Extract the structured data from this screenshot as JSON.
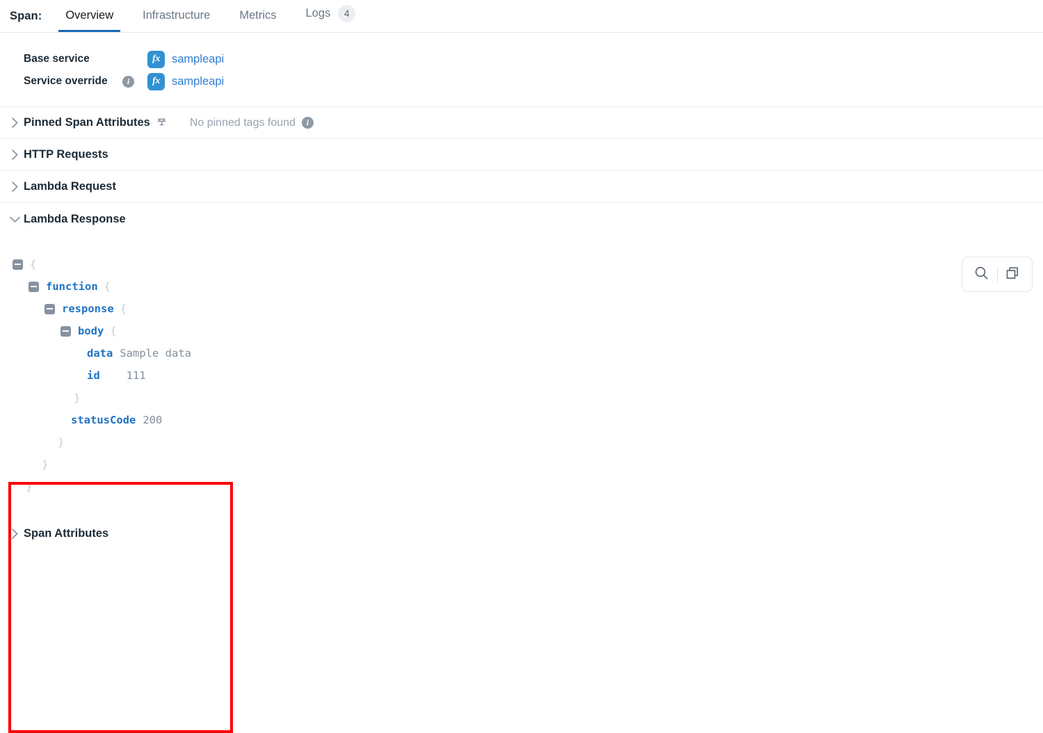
{
  "tabbar": {
    "label": "Span:",
    "tabs": [
      {
        "label": "Overview",
        "active": true,
        "badge": ""
      },
      {
        "label": "Infrastructure",
        "active": false,
        "badge": ""
      },
      {
        "label": "Metrics",
        "active": false,
        "badge": ""
      },
      {
        "label": "Logs",
        "active": false,
        "badge": "4"
      }
    ]
  },
  "service": {
    "base_label": "Base service",
    "base_value": "sampleapi",
    "override_label": "Service override",
    "override_value": "sampleapi",
    "fx_icon_text": "fx",
    "info_icon_text": "i"
  },
  "sections": {
    "pinned": {
      "title": "Pinned Span Attributes",
      "note": "No pinned tags found",
      "expanded": false
    },
    "http_requests": {
      "title": "HTTP Requests",
      "expanded": false
    },
    "lambda_request": {
      "title": "Lambda Request",
      "expanded": false
    },
    "lambda_response": {
      "title": "Lambda Response",
      "expanded": true
    },
    "span_attributes": {
      "title": "Span Attributes",
      "expanded": false
    }
  },
  "json_tree": {
    "rows": [
      {
        "indent": 0,
        "toggle": true,
        "key": "",
        "open": "{",
        "value": ""
      },
      {
        "indent": 1,
        "toggle": true,
        "key": "function",
        "open": "{",
        "value": ""
      },
      {
        "indent": 2,
        "toggle": true,
        "key": "response",
        "open": "{",
        "value": ""
      },
      {
        "indent": 3,
        "toggle": true,
        "key": "body",
        "open": "{",
        "value": ""
      },
      {
        "indent": 4,
        "toggle": false,
        "key": "data",
        "open": "",
        "value": "Sample data"
      },
      {
        "indent": 4,
        "toggle": false,
        "key": "id",
        "open": "",
        "value": "111"
      },
      {
        "indent": 3,
        "toggle": false,
        "key": "",
        "open": "}",
        "value": ""
      },
      {
        "indent": 3,
        "toggle": false,
        "key": "statusCode",
        "open": "",
        "value": "200"
      },
      {
        "indent": 2,
        "toggle": false,
        "key": "",
        "open": "}",
        "value": ""
      },
      {
        "indent": 1,
        "toggle": false,
        "key": "",
        "open": "}",
        "value": ""
      },
      {
        "indent": 0,
        "toggle": false,
        "key": "",
        "open": "}",
        "value": ""
      }
    ]
  },
  "tools": {
    "search_icon": "search-icon",
    "copy_icon": "copy-icon"
  },
  "colors": {
    "accent_blue": "#1669b8",
    "link_blue": "#2f7ed1",
    "key_blue": "#1f73c4",
    "fx_badge": "#3191d3",
    "highlight_red": "#fb0006",
    "muted": "#98a2ae"
  }
}
